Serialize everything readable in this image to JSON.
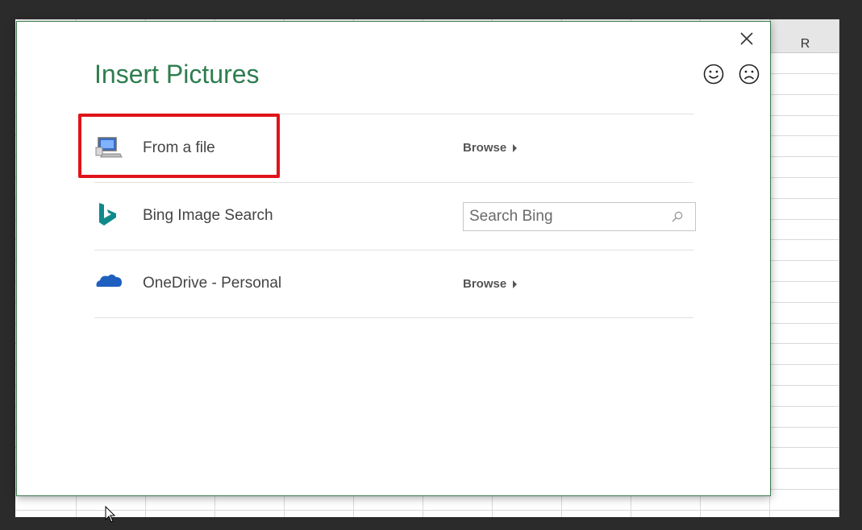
{
  "spreadsheet": {
    "column_label": "R"
  },
  "dialog": {
    "title": "Insert Pictures",
    "close_icon": "close-icon",
    "smile_icon": "smile-icon",
    "frown_icon": "frown-icon"
  },
  "rows": [
    {
      "label": "From a file",
      "icon": "computer-icon",
      "action": "Browse"
    },
    {
      "label": "Bing Image Search",
      "icon": "bing-icon",
      "search_placeholder": "Search Bing"
    },
    {
      "label": "OneDrive - Personal",
      "icon": "onedrive-icon",
      "action": "Browse"
    }
  ],
  "colors": {
    "title": "#2e7d4f",
    "dialog_border": "#3d7a4f",
    "highlight": "#e0141b",
    "bing": "#0f8a8a",
    "onedrive": "#1f5fbf"
  }
}
